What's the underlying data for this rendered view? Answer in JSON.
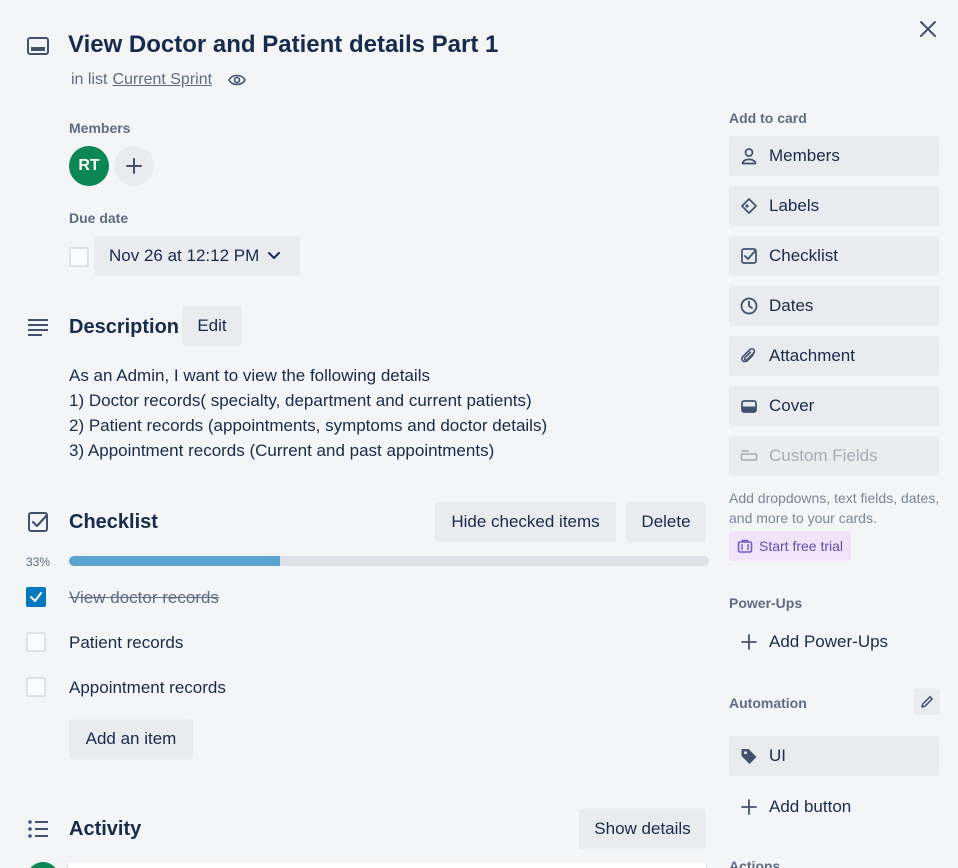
{
  "card": {
    "title": "View Doctor and Patient details Part 1",
    "in_list_prefix": "in list",
    "list_name": "Current Sprint"
  },
  "members": {
    "label": "Members",
    "avatar_initials": "RT",
    "avatar_color": "#0a8753"
  },
  "due_date": {
    "label": "Due date",
    "value": "Nov 26 at 12:12 PM"
  },
  "description": {
    "title": "Description",
    "edit_label": "Edit",
    "lines": [
      "As an Admin, I want to view the following details",
      "1) Doctor records( specialty, department and current patients)",
      "2) Patient records (appointments, symptoms and doctor details)",
      "3) Appointment records (Current and past appointments)"
    ]
  },
  "checklist": {
    "title": "Checklist",
    "hide_checked_label": "Hide checked items",
    "delete_label": "Delete",
    "progress_text": "33%",
    "progress_fraction": 0.33,
    "progress_color": "#5ba4cf",
    "items": [
      {
        "text": "View doctor records",
        "checked": true
      },
      {
        "text": "Patient records",
        "checked": false
      },
      {
        "text": "Appointment records",
        "checked": false
      }
    ],
    "add_item_label": "Add an item"
  },
  "activity": {
    "title": "Activity",
    "show_details_label": "Show details"
  },
  "sidebar": {
    "add_to_card_label": "Add to card",
    "buttons": [
      {
        "label": "Members",
        "icon": "person-icon"
      },
      {
        "label": "Labels",
        "icon": "tag-icon"
      },
      {
        "label": "Checklist",
        "icon": "checklist-icon"
      },
      {
        "label": "Dates",
        "icon": "clock-icon"
      },
      {
        "label": "Attachment",
        "icon": "paperclip-icon"
      },
      {
        "label": "Cover",
        "icon": "cover-icon"
      },
      {
        "label": "Custom Fields",
        "icon": "custom-fields-icon"
      }
    ],
    "custom_fields_hint": "Add dropdowns, text fields, dates, and more to your cards.",
    "start_trial_label": "Start free trial",
    "powerups_label": "Power-Ups",
    "add_powerups_label": "Add Power-Ups",
    "automation_label": "Automation",
    "automation_ui_label": "UI",
    "add_button_label": "Add button",
    "actions_label": "Actions"
  }
}
